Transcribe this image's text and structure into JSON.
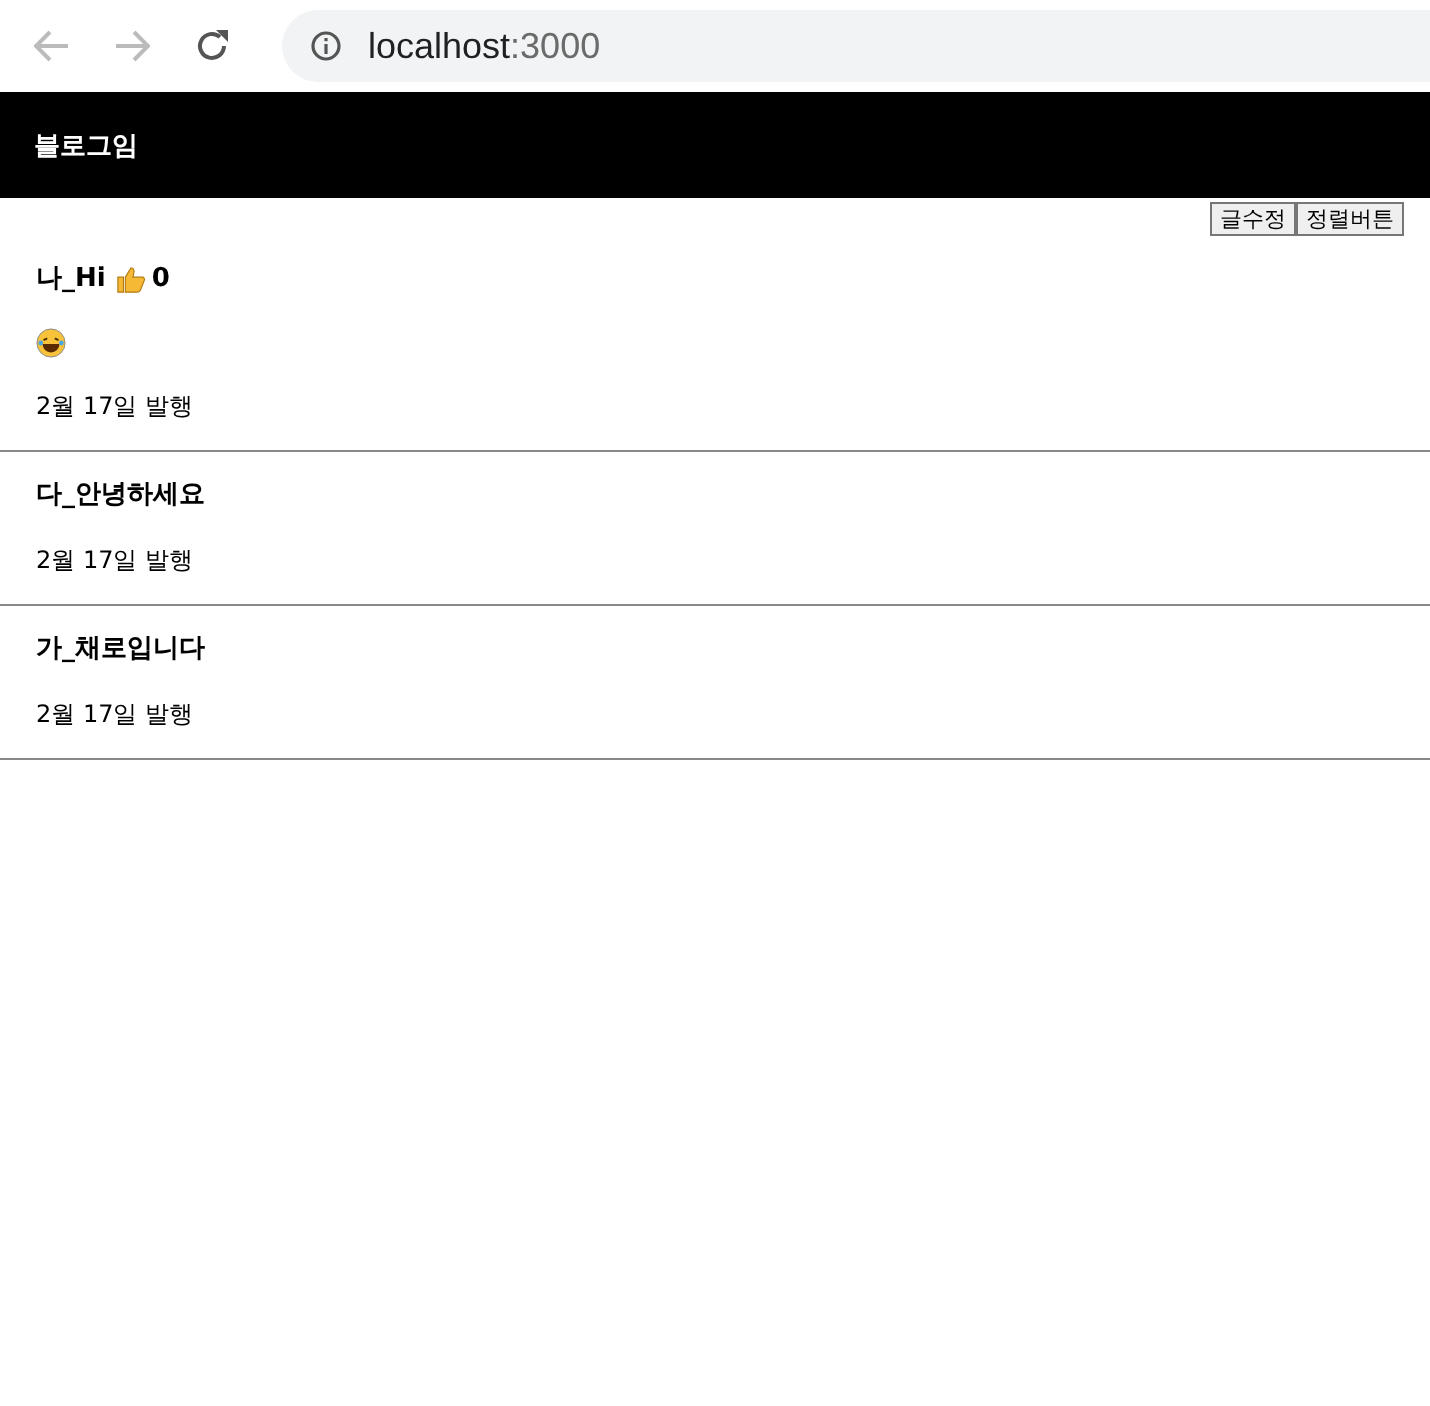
{
  "browser": {
    "url_host": "localhost",
    "url_port": ":3000"
  },
  "header": {
    "title": "블로그임"
  },
  "buttons": [
    "글수정",
    "정렬버튼"
  ],
  "posts": [
    {
      "title": "나_Hi",
      "likes": "0",
      "show_emoji": true,
      "date": "2월 17일 발행"
    },
    {
      "title": "다_안녕하세요",
      "show_emoji": false,
      "date": "2월 17일 발행"
    },
    {
      "title": "가_채로입니다",
      "show_emoji": false,
      "date": "2월 17일 발행"
    }
  ]
}
